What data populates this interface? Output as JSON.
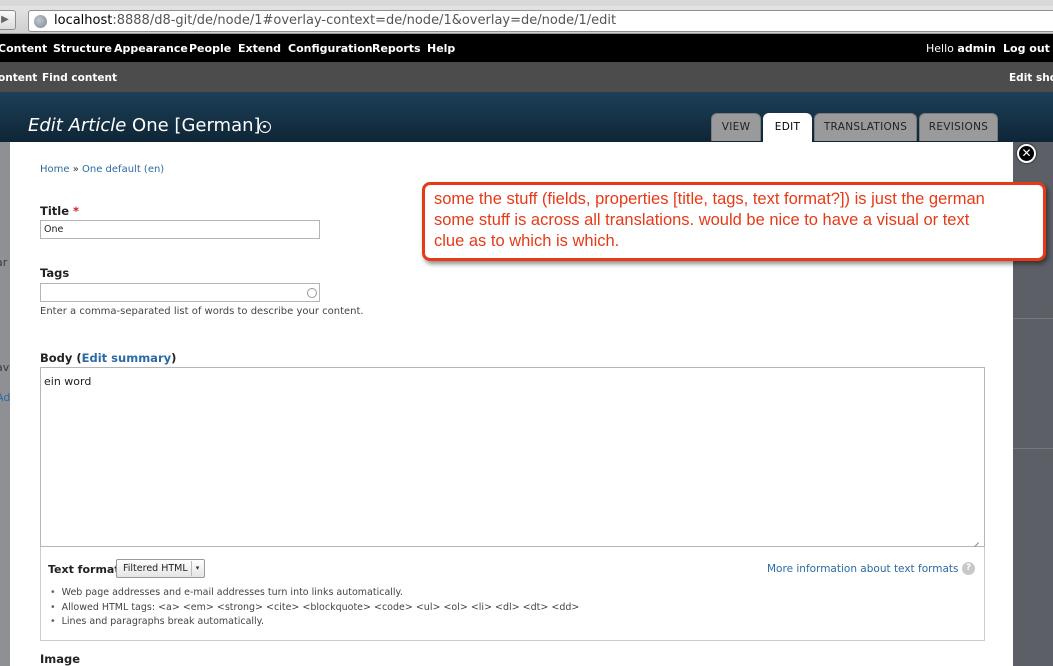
{
  "browser": {
    "back_glyph": "▶",
    "url_host": "localhost",
    "url_rest": ":8888/d8-git/de/node/1#overlay-context=de/node/1&overlay=de/node/1/edit"
  },
  "toolbar": {
    "items": [
      "Content",
      "Structure",
      "Appearance",
      "People",
      "Extend",
      "Configuration",
      "Reports",
      "Help"
    ],
    "hello_prefix": "Hello ",
    "username": "admin",
    "logout": "Log out"
  },
  "shortcuts": {
    "add_content": "ontent",
    "find_content": "Find content",
    "edit_shortcuts": "Edit short"
  },
  "header": {
    "title_italic": "Edit Article",
    "title_rest": " One [German]",
    "tabs": [
      {
        "label": "VIEW",
        "active": false
      },
      {
        "label": "EDIT",
        "active": true
      },
      {
        "label": "TRANSLATIONS",
        "active": false
      },
      {
        "label": "REVISIONS",
        "active": false
      }
    ],
    "close_glyph": "✕"
  },
  "background_page": {
    "left_fragments": [
      "ar",
      "av",
      "Ad"
    ]
  },
  "breadcrumb": {
    "home": "Home",
    "separator": " » ",
    "current": "One default (en)"
  },
  "form": {
    "title": {
      "label": "Title",
      "required_mark": "*",
      "value": "One"
    },
    "tags": {
      "label": "Tags",
      "value": "",
      "description": "Enter a comma-separated list of words to describe your content."
    },
    "body": {
      "label_prefix": "Body (",
      "edit_summary": "Edit summary",
      "label_suffix": ")",
      "value": "ein word"
    },
    "text_format": {
      "label": "Text format",
      "selected": "Filtered HTML",
      "select_arrow": "▾",
      "more_info": "More information about text formats",
      "help_glyph": "?",
      "tips": [
        "Web page addresses and e-mail addresses turn into links automatically.",
        "Allowed HTML tags: <a> <em> <strong> <cite> <blockquote> <code> <ul> <ol> <li> <dl> <dt> <dd>",
        "Lines and paragraphs break automatically."
      ]
    },
    "image": {
      "label": "Image"
    }
  },
  "annotation": {
    "lines": [
      "some the stuff (fields, properties [title, tags, text format?]) is just the german",
      "some stuff is across all translations. would be nice to have a visual or text",
      "clue as to which is which."
    ]
  },
  "colors": {
    "annotation_red": "#e63a17",
    "link_blue": "#2c6aa5",
    "toolbar_black": "#000000",
    "overlay_header": "#1d4058"
  }
}
